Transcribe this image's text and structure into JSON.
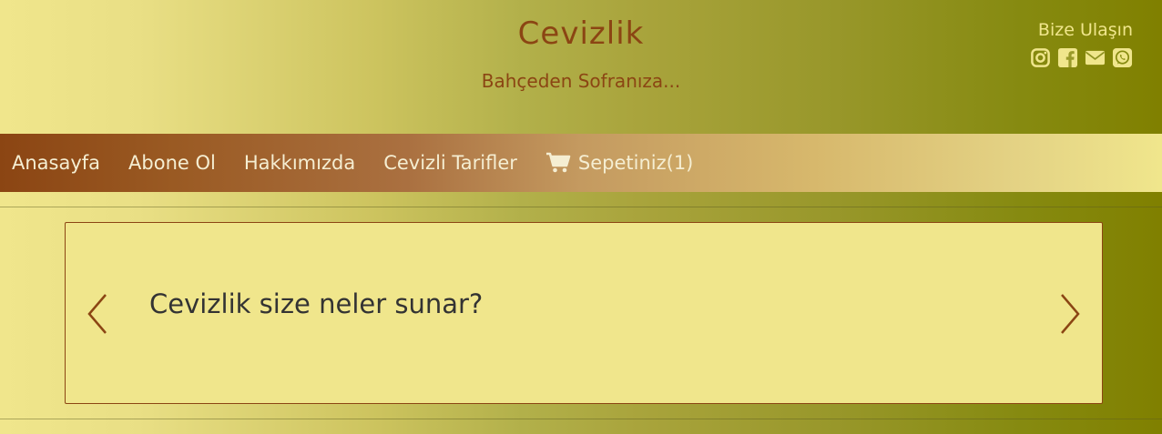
{
  "header": {
    "title": "Cevizlik",
    "tagline": "Bahçeden Sofranıza...",
    "contact_label": "Bize Ulaşın",
    "social_icons": [
      "instagram-icon",
      "facebook-icon",
      "envelope-icon",
      "whatsapp-icon"
    ]
  },
  "nav": {
    "items": [
      {
        "label": "Anasayfa"
      },
      {
        "label": "Abone Ol"
      },
      {
        "label": "Hakkımızda"
      },
      {
        "label": "Cevizli Tarifler"
      },
      {
        "label": "Sepetiniz(1)",
        "icon": "cart-icon"
      }
    ]
  },
  "carousel": {
    "slide_text": "Cevizlik size neler sunar?",
    "prev_icon": "chevron-left-icon",
    "next_icon": "chevron-right-icon"
  },
  "colors": {
    "brand_brown": "#8b4513",
    "khaki": "#f0e68c",
    "olive": "#808000"
  }
}
